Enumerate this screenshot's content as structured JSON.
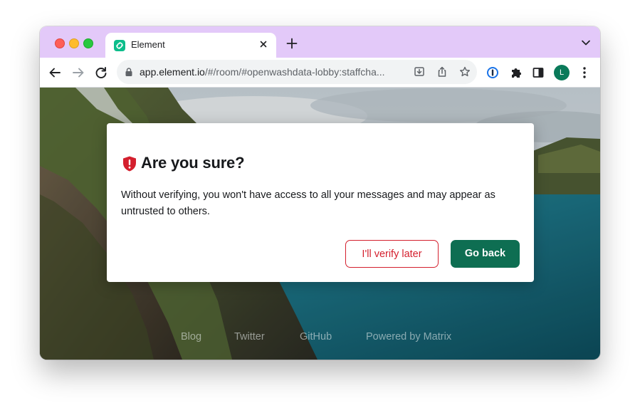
{
  "tab": {
    "title": "Element"
  },
  "toolbar": {
    "url_host": "app.element.io",
    "url_rest": "/#/room/#openwashdata-lobby:staffcha...",
    "avatar_letter": "L"
  },
  "dialog": {
    "title": "Are you sure?",
    "body": "Without verifying, you won't have access to all your messages and may appear as untrusted to others.",
    "later_label": "I'll verify later",
    "back_label": "Go back"
  },
  "footer": {
    "links": [
      "Blog",
      "Twitter",
      "GitHub",
      "Powered by Matrix"
    ]
  },
  "colors": {
    "tabstrip": "#e3c9f9",
    "primary_button": "#0e6e52",
    "danger": "#d4202e",
    "element_brand": "#0dbd8b"
  },
  "icons": {
    "shield": "shield-warning-icon",
    "lock": "lock-icon"
  }
}
